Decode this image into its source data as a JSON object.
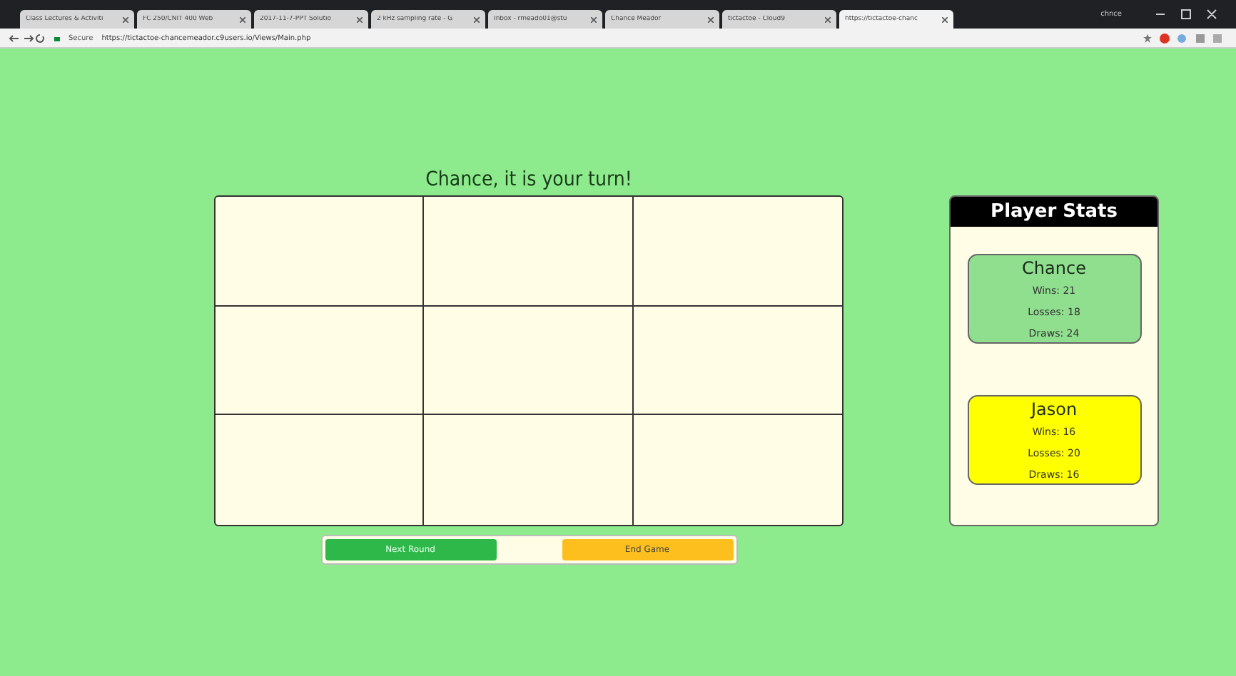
{
  "browser": {
    "tabs": [
      {
        "title": "Class Lectures & Activiti",
        "selected": false
      },
      {
        "title": "FC 250/CNIT 400 Web",
        "selected": false
      },
      {
        "title": "2017-11-7-PPT Solutio",
        "selected": false
      },
      {
        "title": "2 kHz sampling rate - G",
        "selected": false
      },
      {
        "title": "Inbox - rmeado01@stu",
        "selected": false
      },
      {
        "title": "Chance Meador",
        "selected": false
      },
      {
        "title": "tictactoe - Cloud9",
        "selected": false
      },
      {
        "title": "https://tictactoe-chanc",
        "selected": true
      }
    ],
    "user": "chnce",
    "secure_label": "Secure",
    "url": "https://tictactoe-chancemeador.c9users.io/Views/Main.php"
  },
  "game": {
    "status": "Chance, it is your turn!",
    "buttons": [
      {
        "label": "Next Round",
        "kind": "next"
      },
      {
        "label": "End Game",
        "kind": "end"
      }
    ]
  },
  "stats": {
    "title": "Player Stats",
    "players": [
      {
        "name": "Chance",
        "color": "#8fdf8f",
        "lines": [
          "Wins: 21",
          "Losses: 18",
          "Draws: 24"
        ]
      },
      {
        "name": "Jason",
        "color": "#ffff00",
        "lines": [
          "Wins: 16",
          "Losses: 20",
          "Draws: 16"
        ]
      }
    ]
  }
}
